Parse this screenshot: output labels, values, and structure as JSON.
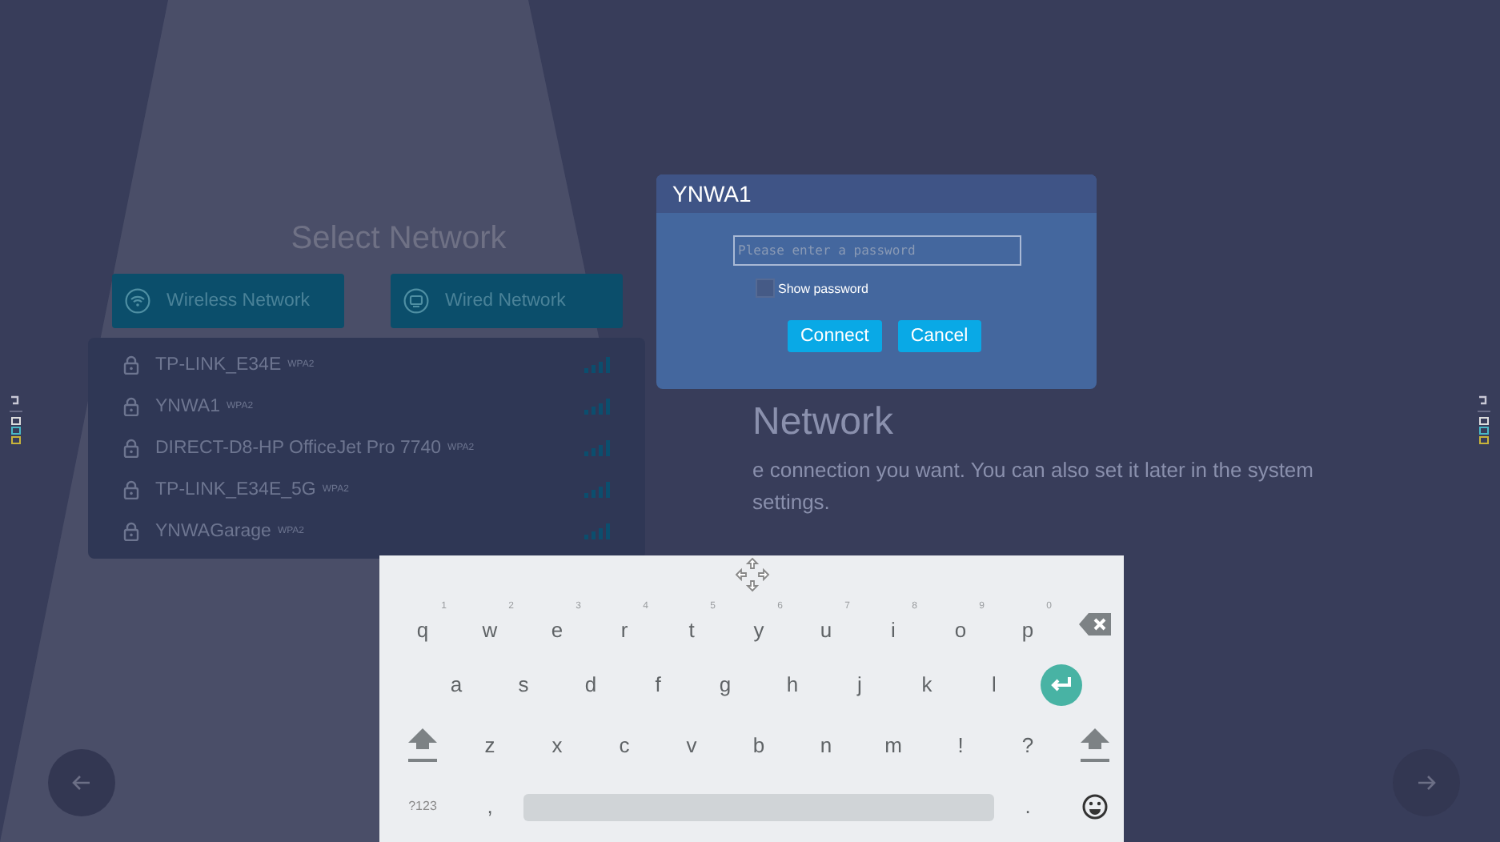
{
  "title": "Select Network",
  "network_types": [
    {
      "label": "Wireless Network",
      "kind": "wireless"
    },
    {
      "label": "Wired Network",
      "kind": "wired"
    }
  ],
  "networks": [
    {
      "name": "TP-LINK_E34E",
      "security": "WPA2"
    },
    {
      "name": "YNWA1",
      "security": "WPA2"
    },
    {
      "name": "DIRECT-D8-HP OfficeJet Pro 7740",
      "security": "WPA2"
    },
    {
      "name": "TP-LINK_E34E_5G",
      "security": "WPA2"
    },
    {
      "name": "YNWAGarage",
      "security": "WPA2"
    }
  ],
  "right_panel": {
    "heading": "Network",
    "description": "e connection you want. You can also set it later in the system settings."
  },
  "dialog": {
    "title": "YNWA1",
    "password": {
      "placeholder": "Please enter a password"
    },
    "show_password": {
      "label": "Show password",
      "checked": false
    },
    "buttons": [
      "Connect",
      "Cancel"
    ]
  },
  "keyboard": {
    "rows": [
      {
        "keys": [
          {
            "kind": "char",
            "key": "q",
            "hint": "1"
          },
          {
            "kind": "char",
            "key": "w",
            "hint": "2"
          },
          {
            "kind": "char",
            "key": "e",
            "hint": "3"
          },
          {
            "kind": "char",
            "key": "r",
            "hint": "4"
          },
          {
            "kind": "char",
            "key": "t",
            "hint": "5"
          },
          {
            "kind": "char",
            "key": "y",
            "hint": "6"
          },
          {
            "kind": "char",
            "key": "u",
            "hint": "7"
          },
          {
            "kind": "char",
            "key": "i",
            "hint": "8"
          },
          {
            "kind": "char",
            "key": "o",
            "hint": "9"
          },
          {
            "kind": "char",
            "key": "p",
            "hint": "0"
          },
          {
            "kind": "backspace"
          }
        ]
      },
      {
        "keys": [
          {
            "kind": "char",
            "key": "a"
          },
          {
            "kind": "char",
            "key": "s"
          },
          {
            "kind": "char",
            "key": "d"
          },
          {
            "kind": "char",
            "key": "f"
          },
          {
            "kind": "char",
            "key": "g"
          },
          {
            "kind": "char",
            "key": "h"
          },
          {
            "kind": "char",
            "key": "j"
          },
          {
            "kind": "char",
            "key": "k"
          },
          {
            "kind": "char",
            "key": "l"
          },
          {
            "kind": "enter"
          }
        ]
      },
      {
        "keys": [
          {
            "kind": "shift"
          },
          {
            "kind": "char",
            "key": "z"
          },
          {
            "kind": "char",
            "key": "x"
          },
          {
            "kind": "char",
            "key": "c"
          },
          {
            "kind": "char",
            "key": "v"
          },
          {
            "kind": "char",
            "key": "b"
          },
          {
            "kind": "char",
            "key": "n"
          },
          {
            "kind": "char",
            "key": "m"
          },
          {
            "kind": "char",
            "key": "!"
          },
          {
            "kind": "char",
            "key": "?"
          },
          {
            "kind": "shift"
          }
        ]
      },
      {
        "keys": [
          {
            "kind": "symbols",
            "key": "?123"
          },
          {
            "kind": "char",
            "key": ","
          },
          {
            "kind": "space"
          },
          {
            "kind": "char",
            "key": "."
          },
          {
            "kind": "emoji"
          }
        ]
      }
    ]
  }
}
